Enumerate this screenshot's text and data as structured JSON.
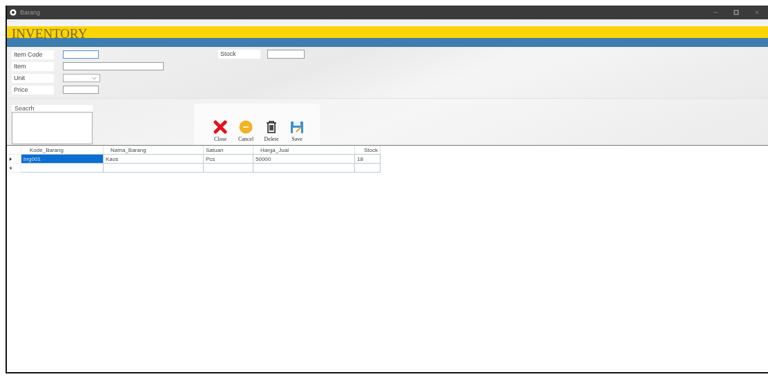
{
  "window": {
    "title": "Barang"
  },
  "header": {
    "title": "INVENTORY"
  },
  "form": {
    "fields": [
      {
        "kind": "text",
        "label": "Item Code",
        "focused": true
      },
      {
        "kind": "text",
        "label": "Item",
        "focused": false
      },
      {
        "kind": "combo",
        "label": "Unit",
        "focused": false
      },
      {
        "kind": "text",
        "label": "Price",
        "focused": false
      }
    ],
    "stock": {
      "label": "Stock"
    }
  },
  "search": {
    "label": "Seacrh"
  },
  "toolbar": [
    {
      "kind": "close",
      "label": "Close"
    },
    {
      "kind": "cancel",
      "label": "Cancel"
    },
    {
      "kind": "delete",
      "label": "Delete"
    },
    {
      "kind": "save",
      "label": "Save"
    }
  ],
  "table": {
    "columns": [
      "Kode_Barang",
      "Nama_Barang",
      "Satuan",
      "Harga_Jual",
      "Stock"
    ],
    "rows": [
      {
        "cells": [
          {
            "text": "brg001",
            "selected": true
          },
          {
            "text": "Kaos",
            "selected": false
          },
          {
            "text": "Pcs",
            "selected": false
          },
          {
            "text": "50000",
            "selected": false
          },
          {
            "text": "18",
            "selected": false
          }
        ],
        "current": true,
        "new_row": false
      },
      {
        "cells": [
          {
            "selected": false
          },
          {
            "selected": false
          },
          {
            "selected": false
          },
          {
            "selected": false
          },
          {
            "selected": false
          }
        ],
        "current": false,
        "new_row": true
      }
    ]
  }
}
